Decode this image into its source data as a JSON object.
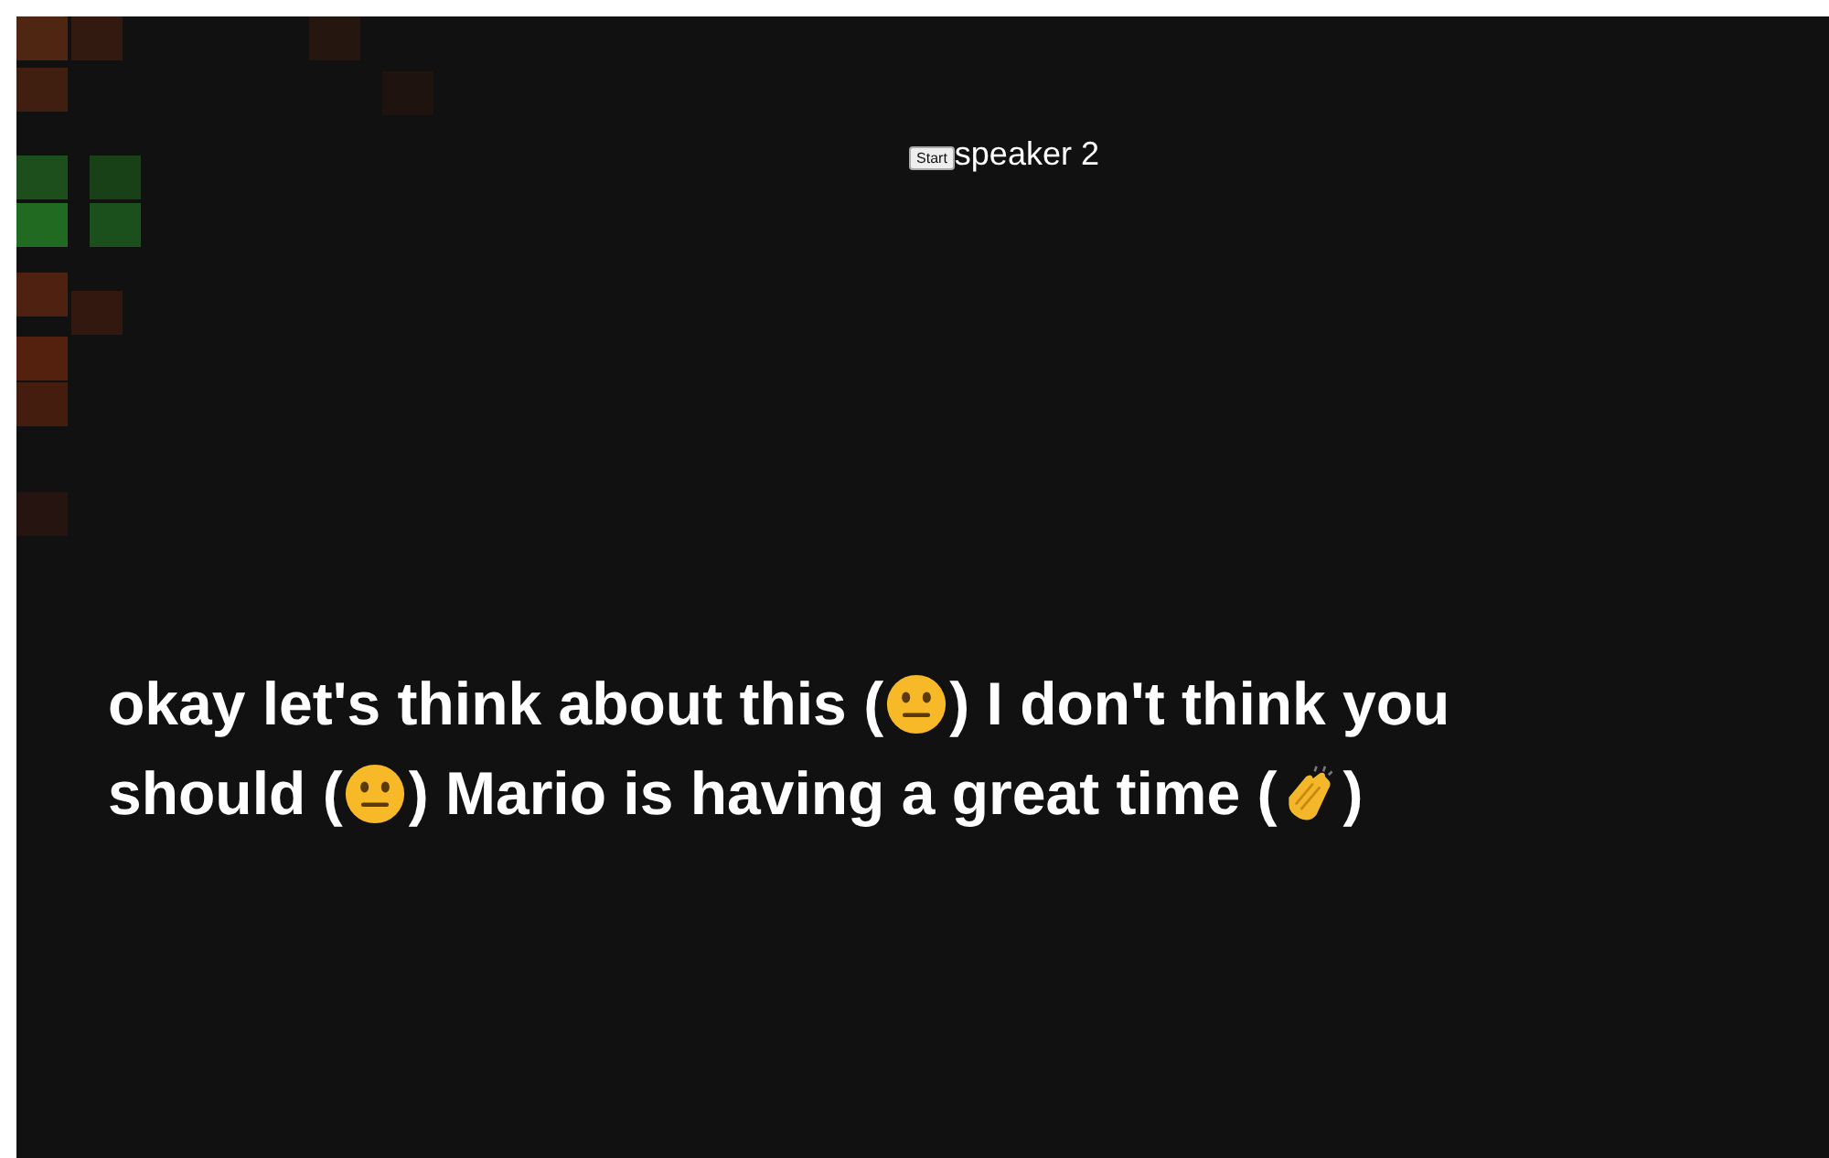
{
  "header": {
    "button": "Start",
    "speaker": "speaker 2"
  },
  "caption": {
    "lines": [
      [
        {
          "kind": "text",
          "text": "okay let's think about this ("
        },
        {
          "kind": "neutral_face"
        },
        {
          "kind": "text",
          "text": ") I don't think you"
        }
      ],
      [
        {
          "kind": "text",
          "text": "should ("
        },
        {
          "kind": "neutral_face"
        },
        {
          "kind": "text",
          "text": ") Mario is having a great time ("
        },
        {
          "kind": "clapping_hands"
        },
        {
          "kind": "text",
          "text": ")"
        }
      ]
    ]
  }
}
